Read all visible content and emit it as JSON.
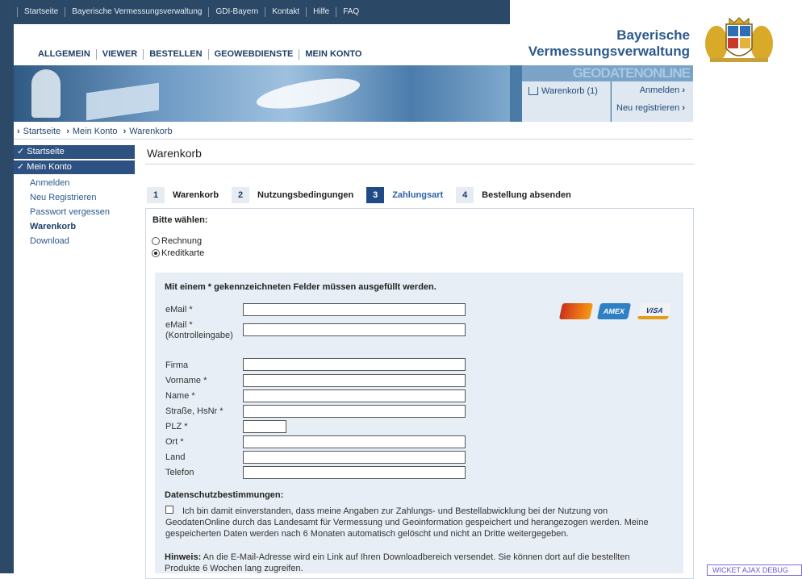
{
  "topnav": [
    "Startseite",
    "Bayerische Vermessungsverwaltung",
    "GDI-Bayern",
    "Kontakt",
    "Hilfe",
    "FAQ"
  ],
  "mainnav": [
    "ALLGEMEIN",
    "VIEWER",
    "BESTELLEN",
    "GEOWEBDIENSTE",
    "MEIN KONTO"
  ],
  "brand": {
    "line1": "Bayerische",
    "line2": "Vermessungsverwaltung",
    "banner_text": "GEODATENONLINE"
  },
  "header": {
    "cart": "Warenkorb (1)",
    "login": "Anmelden",
    "register": "Neu registrieren",
    "arrow": "›"
  },
  "breadcrumb": [
    "Startseite",
    "Mein Konto",
    "Warenkorb"
  ],
  "breadcrumb_sep": "›",
  "sidebar": {
    "startseite": "Startseite",
    "meinkonto": "Mein Konto",
    "items": [
      "Anmelden",
      "Neu Registrieren",
      "Passwort vergessen",
      "Warenkorb",
      "Download"
    ]
  },
  "content": {
    "title": "Warenkorb",
    "steps": [
      {
        "num": "1",
        "label": "Warenkorb"
      },
      {
        "num": "2",
        "label": "Nutzungsbedingungen"
      },
      {
        "num": "3",
        "label": "Zahlungsart"
      },
      {
        "num": "4",
        "label": "Bestellung absenden"
      }
    ],
    "choose": "Bitte wählen:",
    "payment_options": [
      "Rechnung",
      "Kreditkarte"
    ],
    "selected_option": "Kreditkarte",
    "required_note": "Mit einem * gekennzeichneten Felder müssen ausgefüllt werden.",
    "fields": {
      "email": "eMail *",
      "email2a": "eMail *",
      "email2b": "(Kontrolleingabe)",
      "firma": "Firma",
      "vorname": "Vorname *",
      "name": "Name *",
      "strasse": "Straße, HsNr *",
      "plz": "PLZ *",
      "ort": "Ort *",
      "land": "Land",
      "telefon": "Telefon"
    },
    "cards": {
      "amex": "AMEX",
      "visa": "VISA"
    },
    "privacy_title": "Datenschutzbestimmungen:",
    "privacy_text": "Ich bin damit einverstanden, dass meine Angaben zur Zahlungs- und Bestellabwicklung bei der Nutzung von GeodatenOnline durch das Landesamt für Vermessung und Geoinformation gespeichert und herangezogen werden. Meine gespeicherten Daten werden nach 6 Monaten automatisch gelöscht und nicht an Dritte weitergegeben.",
    "hint_label": "Hinweis:",
    "hint_text": " An die E-Mail-Adresse wird ein Link auf Ihren Downloadbereich versendet. Sie können dort auf die bestellten Produkte 6 Wochen lang zugreifen."
  },
  "debug": "WICKET AJAX DEBUG"
}
